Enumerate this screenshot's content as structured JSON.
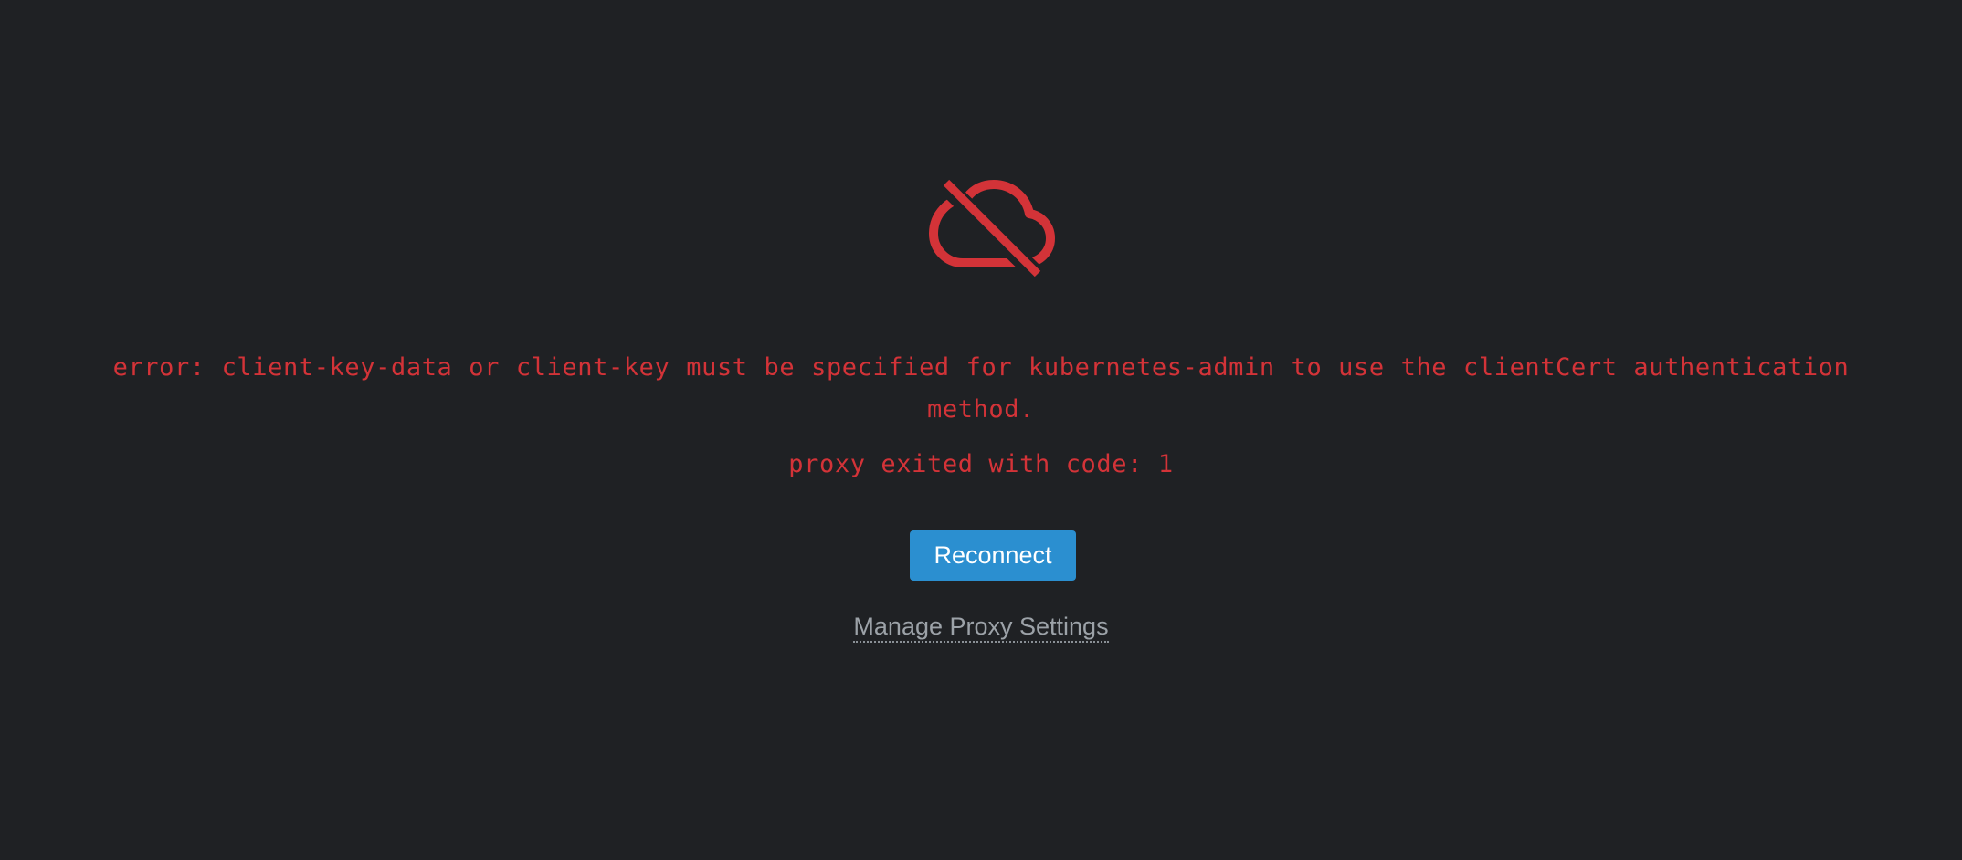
{
  "status": {
    "icon": "cloud-off-icon",
    "error_message": "error: client-key-data or client-key must be specified for kubernetes-admin to use the clientCert authentication method.",
    "exit_message": "proxy exited with code: 1"
  },
  "actions": {
    "reconnect_label": "Reconnect",
    "manage_proxy_label": "Manage Proxy Settings"
  },
  "colors": {
    "background": "#1f2124",
    "error": "#d33338",
    "primary_button": "#2b8fd0",
    "link": "#9ca2a8"
  }
}
